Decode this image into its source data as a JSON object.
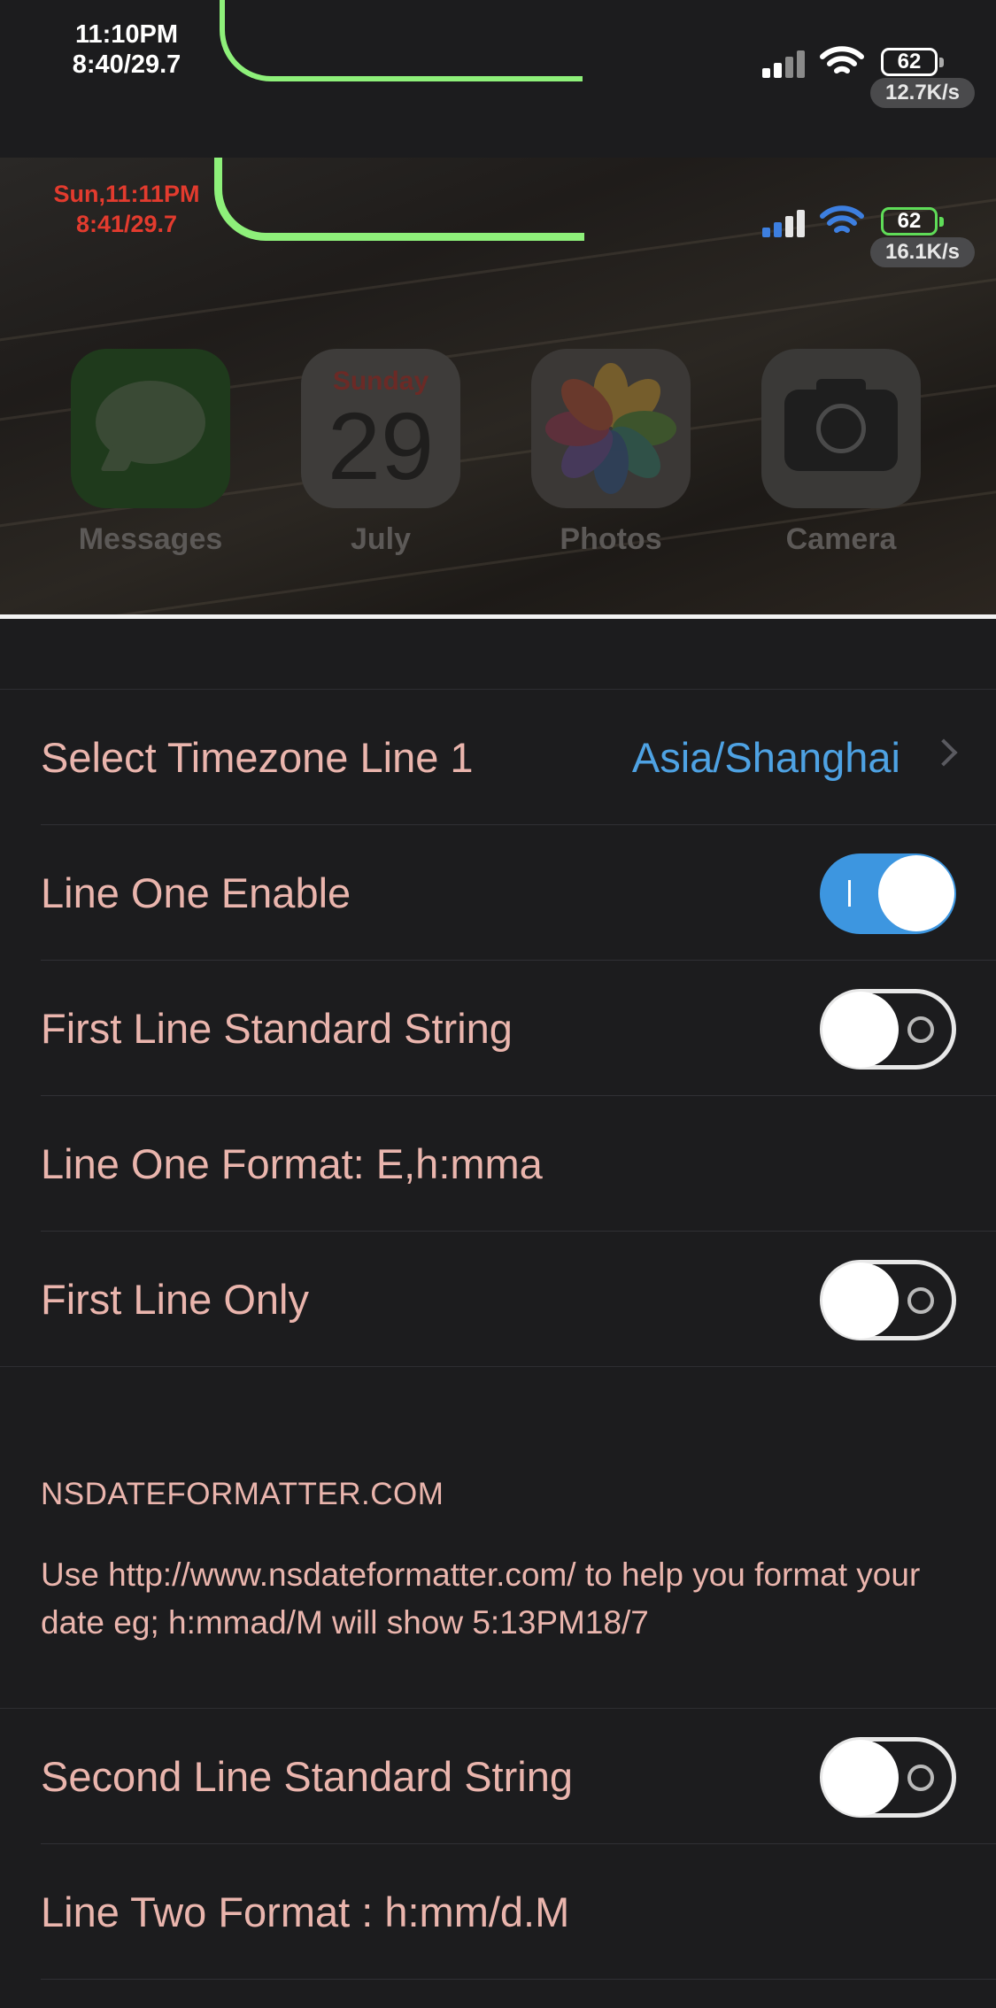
{
  "status_bar": {
    "time_line1": "11:10PM",
    "time_line2": "8:40/29.7",
    "battery": "62",
    "net_speed": "12.7K/s"
  },
  "preview": {
    "time_line1": "Sun,11:11PM",
    "time_line2": "8:41/29.7",
    "battery": "62",
    "net_speed": "16.1K/s",
    "apps": [
      {
        "label": "Messages"
      },
      {
        "label": "July",
        "day": "Sunday",
        "date": "29"
      },
      {
        "label": "Photos"
      },
      {
        "label": "Camera"
      }
    ]
  },
  "settings": {
    "timezone_label": "Select Timezone Line 1",
    "timezone_value": "Asia/Shanghai",
    "line_one_enable": "Line One Enable",
    "line_one_enable_on": true,
    "first_line_standard": "First Line Standard String",
    "first_line_standard_on": false,
    "line_one_format": "Line One Format:  E,h:mma",
    "first_line_only": "First Line Only",
    "first_line_only_on": false,
    "section_header": "NSDATEFORMATTER.COM",
    "section_footer": "Use http://www.nsdateformatter.com/ to help you format your date eg; h:mmad/M will show 5:13PM18/7",
    "second_line_standard": "Second Line Standard String",
    "second_line_standard_on": false,
    "line_two_format": "Line Two Format :  h:mm/d.M"
  },
  "colors": {
    "background": "#1c1c1e",
    "label": "#eab5ad",
    "accent_blue": "#3d96e0",
    "notch_green": "#8ef07a",
    "preview_time_red": "#e33b2e"
  }
}
